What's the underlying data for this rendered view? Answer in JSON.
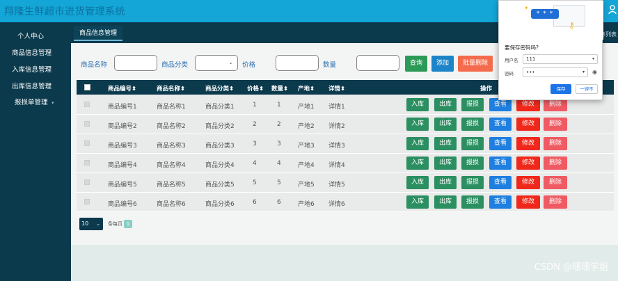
{
  "app": {
    "title": "翔隆生鲜超市进货管理系统"
  },
  "sidebar": {
    "items": [
      {
        "label": "个人中心"
      },
      {
        "label": "商品信息管理"
      },
      {
        "label": "入库信息管理"
      },
      {
        "label": "出库信息管理"
      },
      {
        "label": "报损单管理"
      }
    ]
  },
  "tabs": [
    {
      "label": "商品信息管理"
    }
  ],
  "tab_right_text": "息列表",
  "filters": {
    "name_label": "商品名称",
    "category_label": "商品分类",
    "price_label": "价格",
    "qty_label": "数量",
    "query_button": "查询",
    "add_button": "添加",
    "batch_delete_button": "批量删除"
  },
  "table": {
    "headers": [
      "商品编号",
      "商品名称",
      "商品分类",
      "价格",
      "数量",
      "产地",
      "详情",
      "操作"
    ],
    "sort_glyph": "⬍",
    "rows": [
      [
        "商品编号1",
        "商品名称1",
        "商品分类1",
        "1",
        "1",
        "产地1",
        "详情1"
      ],
      [
        "商品编号2",
        "商品名称2",
        "商品分类2",
        "2",
        "2",
        "产地2",
        "详情2"
      ],
      [
        "商品编号3",
        "商品名称3",
        "商品分类3",
        "3",
        "3",
        "产地3",
        "详情3"
      ],
      [
        "商品编号4",
        "商品名称4",
        "商品分类4",
        "4",
        "4",
        "产地4",
        "详情4"
      ],
      [
        "商品编号5",
        "商品名称5",
        "商品分类5",
        "5",
        "5",
        "产地5",
        "详情5"
      ],
      [
        "商品编号6",
        "商品名称6",
        "商品分类6",
        "6",
        "6",
        "产地6",
        "详情6"
      ]
    ],
    "row_actions": [
      "入库",
      "出库",
      "报损",
      "查看",
      "修改",
      "删除"
    ]
  },
  "pager": {
    "page_size": "10",
    "per_page_label": "条每页",
    "current_page": "1"
  },
  "password_popup": {
    "masked_display": "* * *",
    "title": "要保存密码吗?",
    "username_label": "用户名",
    "username_value": "111",
    "password_label": "密码",
    "password_value": "•••",
    "save_button": "保存",
    "never_button": "一律不"
  },
  "watermark": "CSDN @珊珊学姐",
  "colors": {
    "topbar": "#13a6d6",
    "sidebar": "#0b3a4d",
    "query": "#2b9a57",
    "add": "#1c84c8",
    "batch_delete": "#f46c4d",
    "instock": "#2b8f61",
    "view": "#1e7fe0",
    "edit": "#f0281b",
    "delete": "#f05a62"
  }
}
